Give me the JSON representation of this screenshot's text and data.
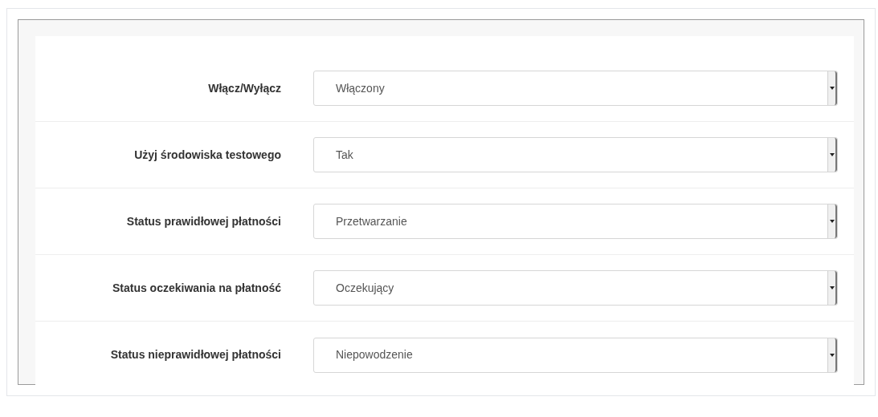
{
  "fields": [
    {
      "label": "Włącz/Wyłącz",
      "value": "Włączony"
    },
    {
      "label": "Użyj środowiska testowego",
      "value": "Tak"
    },
    {
      "label": "Status prawidłowej płatności",
      "value": "Przetwarzanie"
    },
    {
      "label": "Status oczekiwania na płatność",
      "value": "Oczekujący"
    },
    {
      "label": "Status nieprawidłowej płatności",
      "value": "Niepowodzenie"
    }
  ]
}
